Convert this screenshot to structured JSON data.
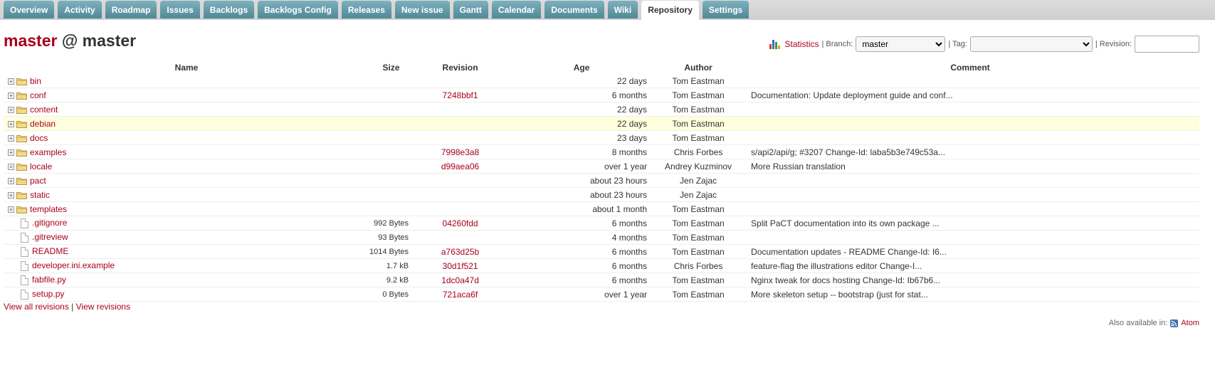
{
  "tabs": [
    {
      "label": "Overview"
    },
    {
      "label": "Activity"
    },
    {
      "label": "Roadmap"
    },
    {
      "label": "Issues"
    },
    {
      "label": "Backlogs"
    },
    {
      "label": "Backlogs Config"
    },
    {
      "label": "Releases"
    },
    {
      "label": "New issue"
    },
    {
      "label": "Gantt"
    },
    {
      "label": "Calendar"
    },
    {
      "label": "Documents"
    },
    {
      "label": "Wiki"
    },
    {
      "label": "Repository",
      "selected": true
    },
    {
      "label": "Settings"
    }
  ],
  "title": {
    "branch": "master",
    "sep": " @ ",
    "path": "master"
  },
  "controls": {
    "statistics": "Statistics",
    "branch_label": "| Branch:",
    "branch_value": "master",
    "tag_label": "| Tag:",
    "tag_value": "",
    "revision_label": "| Revision:",
    "revision_value": ""
  },
  "table": {
    "headers": {
      "name": "Name",
      "size": "Size",
      "revision": "Revision",
      "age": "Age",
      "author": "Author",
      "comment": "Comment"
    },
    "rows": [
      {
        "type": "dir",
        "name": "bin",
        "size": "",
        "revision": "",
        "age": "22 days",
        "author": "Tom Eastman",
        "comment": ""
      },
      {
        "type": "dir",
        "name": "conf",
        "size": "",
        "revision": "7248bbf1",
        "age": "6 months",
        "author": "Tom Eastman",
        "comment": "Documentation: Update deployment guide and conf..."
      },
      {
        "type": "dir",
        "name": "content",
        "size": "",
        "revision": "",
        "age": "22 days",
        "author": "Tom Eastman",
        "comment": ""
      },
      {
        "type": "dir",
        "name": "debian",
        "size": "",
        "revision": "",
        "age": "22 days",
        "author": "Tom Eastman",
        "comment": "",
        "highlight": true
      },
      {
        "type": "dir",
        "name": "docs",
        "size": "",
        "revision": "",
        "age": "23 days",
        "author": "Tom Eastman",
        "comment": ""
      },
      {
        "type": "dir",
        "name": "examples",
        "size": "",
        "revision": "7998e3a8",
        "age": "8 months",
        "author": "Chris Forbes",
        "comment": "s/api2/api/g; #3207 Change-Id: laba5b3e749c53a..."
      },
      {
        "type": "dir",
        "name": "locale",
        "size": "",
        "revision": "d99aea06",
        "age": "over 1 year",
        "author": "Andrey Kuzminov",
        "comment": "More Russian translation"
      },
      {
        "type": "dir",
        "name": "pact",
        "size": "",
        "revision": "",
        "age": "about 23 hours",
        "author": "Jen Zajac",
        "comment": ""
      },
      {
        "type": "dir",
        "name": "static",
        "size": "",
        "revision": "",
        "age": "about 23 hours",
        "author": "Jen Zajac",
        "comment": ""
      },
      {
        "type": "dir",
        "name": "templates",
        "size": "",
        "revision": "",
        "age": "about 1 month",
        "author": "Tom Eastman",
        "comment": ""
      },
      {
        "type": "file",
        "name": ".gitignore",
        "size": "992 Bytes",
        "revision": "04260fdd",
        "age": "6 months",
        "author": "Tom Eastman",
        "comment": "Split PaCT documentation into its own package ..."
      },
      {
        "type": "file",
        "name": ".gitreview",
        "size": "93 Bytes",
        "revision": "",
        "age": "4 months",
        "author": "Tom Eastman",
        "comment": ""
      },
      {
        "type": "file",
        "name": "README",
        "size": "1014 Bytes",
        "revision": "a763d25b",
        "age": "6 months",
        "author": "Tom Eastman",
        "comment": "Documentation updates - README Change-Id: I6..."
      },
      {
        "type": "file",
        "name": "developer.ini.example",
        "size": "1.7 kB",
        "revision": "30d1f521",
        "age": "6 months",
        "author": "Chris Forbes",
        "comment": "feature-flag the illustrations editor Change-I..."
      },
      {
        "type": "file",
        "name": "fabfile.py",
        "size": "9.2 kB",
        "revision": "1dc0a47d",
        "age": "6 months",
        "author": "Tom Eastman",
        "comment": "Nginx tweak for docs hosting Change-Id: Ib67b6..."
      },
      {
        "type": "file",
        "name": "setup.py",
        "size": "0 Bytes",
        "revision": "721aca6f",
        "age": "over 1 year",
        "author": "Tom Eastman",
        "comment": "More skeleton setup -- bootstrap (just for stat..."
      }
    ]
  },
  "footer": {
    "view_all": "View all revisions",
    "sep": " | ",
    "view_revisions": "View revisions",
    "also_available": "Also available in:",
    "atom": "Atom"
  },
  "colors": {
    "link": "#a9001a",
    "tab": "#5e97a4",
    "highlight": "#ffffdd"
  }
}
